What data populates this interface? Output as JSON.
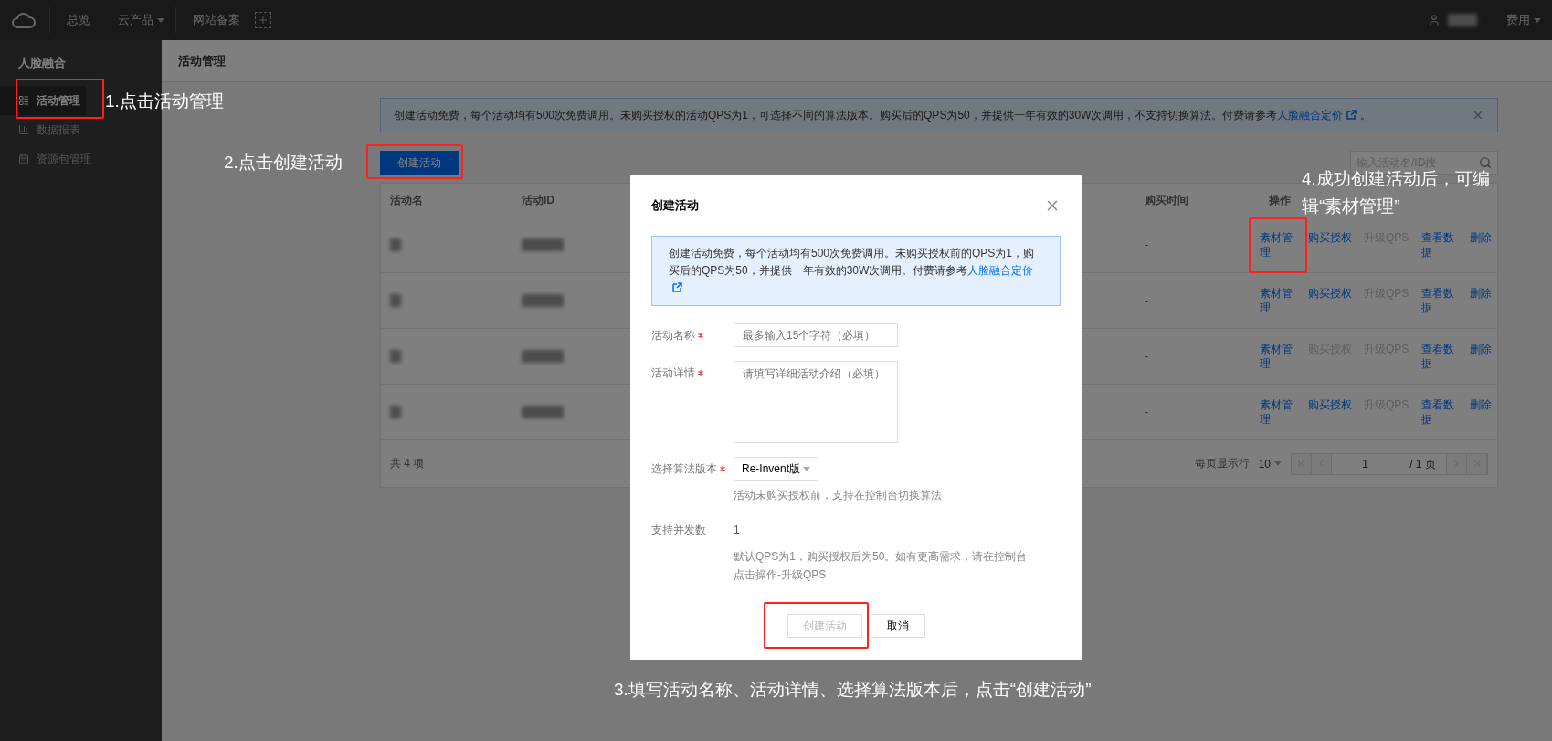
{
  "topbar": {
    "nav": [
      {
        "label": "总览",
        "kind": "link"
      },
      {
        "label": "云产品",
        "kind": "dropdown"
      },
      {
        "label": "网站备案",
        "kind": "link"
      }
    ],
    "account_menu": "费用"
  },
  "sidebar": {
    "title": "人脸融合",
    "items": [
      {
        "label": "活动管理",
        "selected": true
      },
      {
        "label": "数据报表",
        "selected": false
      },
      {
        "label": "资源包管理",
        "selected": false
      }
    ]
  },
  "page": {
    "title": "活动管理"
  },
  "notice": {
    "text": "创建活动免费，每个活动均有500次免费调用。未购买授权的活动QPS为1，可选择不同的算法版本。购买后的QPS为50，并提供一年有效的30W次调用，不支持切换算法。付费请参考",
    "link": "人脸融合定价",
    "suffix": "。"
  },
  "create_button": "创建活动",
  "search": {
    "placeholder": "输入活动名/ID搜"
  },
  "table": {
    "columns": [
      "活动名",
      "活动ID",
      "购买时间",
      "操作"
    ],
    "rows": [
      {
        "purchase_time": "-",
        "actions": [
          {
            "label": "素材管理",
            "disabled": false
          },
          {
            "label": "购买授权",
            "disabled": false
          },
          {
            "label": "升级QPS",
            "disabled": true
          },
          {
            "label": "查看数据",
            "disabled": false
          },
          {
            "label": "删除",
            "disabled": false
          }
        ]
      },
      {
        "purchase_time": "-",
        "actions": [
          {
            "label": "素材管理",
            "disabled": false
          },
          {
            "label": "购买授权",
            "disabled": false
          },
          {
            "label": "升级QPS",
            "disabled": true
          },
          {
            "label": "查看数据",
            "disabled": false
          },
          {
            "label": "删除",
            "disabled": false
          }
        ]
      },
      {
        "purchase_time": "-",
        "actions": [
          {
            "label": "素材管理",
            "disabled": false
          },
          {
            "label": "购买授权",
            "disabled": true
          },
          {
            "label": "升级QPS",
            "disabled": true
          },
          {
            "label": "查看数据",
            "disabled": false
          },
          {
            "label": "删除",
            "disabled": false
          }
        ]
      },
      {
        "purchase_time": "-",
        "actions": [
          {
            "label": "素材管理",
            "disabled": false
          },
          {
            "label": "购买授权",
            "disabled": false
          },
          {
            "label": "升级QPS",
            "disabled": true
          },
          {
            "label": "查看数据",
            "disabled": false
          },
          {
            "label": "删除",
            "disabled": false
          }
        ]
      }
    ],
    "footer": {
      "total": "共 4 项",
      "page_size_label": "每页显示行",
      "page_size": "10",
      "page": "1",
      "page_total": "/ 1 页"
    }
  },
  "modal": {
    "title": "创建活动",
    "notice": {
      "text": "创建活动免费，每个活动均有500次免费调用。未购买授权前的QPS为1，购买后的QPS为50，并提供一年有效的30W次调用。付费请参考",
      "link": "人脸融合定价"
    },
    "fields": [
      {
        "label": "活动名称",
        "required": true,
        "kind": "input",
        "placeholder": "最多输入15个字符（必填）"
      },
      {
        "label": "活动详情",
        "required": true,
        "kind": "textarea",
        "placeholder": "请填写详细活动介绍（必填）"
      },
      {
        "label": "选择算法版本",
        "required": true,
        "kind": "select",
        "value": "Re-Invent版",
        "hint": "活动未购买授权前，支持在控制台切换算法"
      },
      {
        "label": "支持并发数",
        "required": false,
        "kind": "static",
        "value": "1",
        "hint": "默认QPS为1，购买授权后为50。如有更高需求，请在控制台点击操作-升级QPS"
      }
    ],
    "buttons": [
      {
        "label": "创建活动",
        "disabled": true
      },
      {
        "label": "取消",
        "disabled": false
      }
    ]
  },
  "annotations": [
    "1.点击活动管理",
    "2.点击创建活动",
    "3.填写活动名称、活动详情、选择算法版本后，点击“创建活动”",
    "4.成功创建活动后，可编辑“素材管理”"
  ]
}
